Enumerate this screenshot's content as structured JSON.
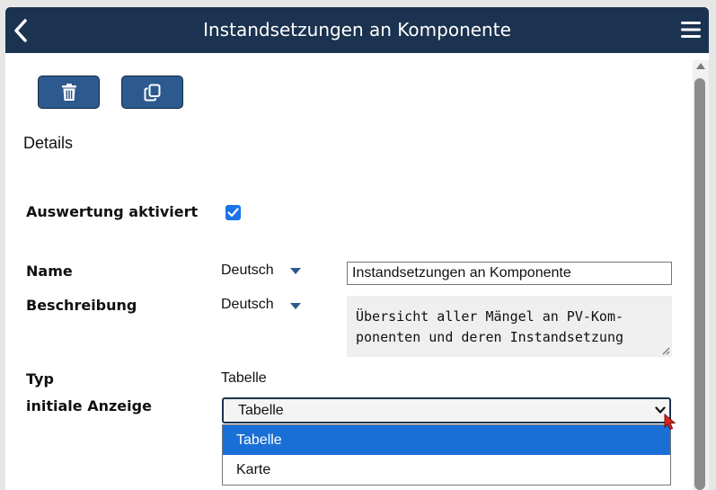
{
  "header": {
    "title": "Instandsetzungen an Komponente",
    "back_icon": "chevron-left-icon",
    "menu_icon": "hamburger-menu-icon"
  },
  "toolbar": {
    "delete_icon": "trash-icon",
    "copy_icon": "copy-icon"
  },
  "section": {
    "title": "Details"
  },
  "fields": {
    "evaluation": {
      "label": "Auswertung aktiviert",
      "checked": true
    },
    "name": {
      "label": "Name",
      "language": "Deutsch",
      "value": "Instandsetzungen an Komponente"
    },
    "description": {
      "label": "Beschreibung",
      "language": "Deutsch",
      "lines": [
        "Übersicht aller Mängel an PV-Kom-",
        "ponenten und deren Instandsetzung"
      ]
    },
    "type": {
      "label": "Typ",
      "value": "Tabelle"
    },
    "initial_view": {
      "label": "initiale Anzeige",
      "selected": "Tabelle",
      "options": [
        "Tabelle",
        "Karte"
      ]
    }
  },
  "colors": {
    "header_bg": "#1b3350",
    "button_bg": "#2c5a8e",
    "accent": "#1a73e8",
    "option_selected": "#1a6fd6"
  }
}
